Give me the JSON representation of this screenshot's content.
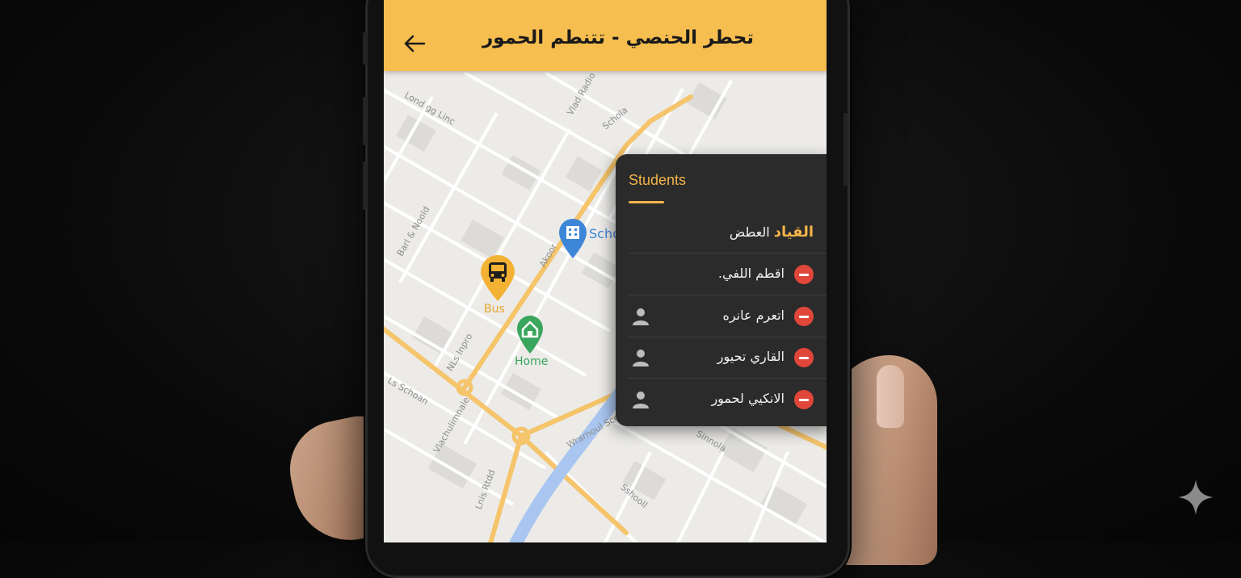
{
  "app": {
    "title": "تحطر الحنصي - تتنطم الحمور",
    "accent_color": "#f6bd4f",
    "back_icon": "arrow-left-icon"
  },
  "map": {
    "pins": {
      "bus": {
        "label": "Bus",
        "icon": "bus-icon",
        "color": "#f3b234"
      },
      "school": {
        "label": "Scho",
        "icon": "school-building-icon",
        "color": "#3d86d8"
      },
      "home": {
        "label": "Home",
        "icon": "home-icon",
        "color": "#3aa55c"
      }
    },
    "street_labels": [
      "Vlad Radio",
      "Schola",
      "Lond gg Linc",
      "Barl & Noold",
      "Akoor",
      "NLs Inpro",
      "Ls Schoan",
      "Vlachulimnale",
      "Wrarnoul Scein",
      "Sinnola",
      "Lnis Rtdd",
      "Sshooll"
    ]
  },
  "students_panel": {
    "title": "Students",
    "header_row": {
      "highlight": "القياد",
      "rest": "العطض"
    },
    "students": [
      {
        "name": "اقطم اللفي.",
        "has_avatar": false
      },
      {
        "name": "اتعرم عانره",
        "has_avatar": true
      },
      {
        "name": "القاري تحيور",
        "has_avatar": true
      },
      {
        "name": "الانكيي لحمور",
        "has_avatar": true
      }
    ],
    "remove_color": "#e0463a",
    "highlight_color": "#f3b54a"
  }
}
